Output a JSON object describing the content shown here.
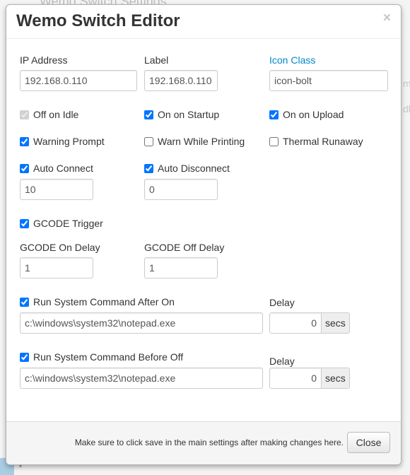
{
  "background": {
    "title_fragment": "Wemo Switch Settings",
    "frag_1": "m",
    "frag_2": "dle"
  },
  "modal": {
    "title": "Wemo Switch Editor",
    "close_symbol": "×",
    "fields": {
      "ip_address": {
        "label": "IP Address",
        "value": "192.168.0.110"
      },
      "label": {
        "label": "Label",
        "value": "192.168.0.110"
      },
      "icon_class": {
        "label": "Icon Class",
        "value": "icon-bolt"
      }
    },
    "checkboxes": {
      "off_on_idle": {
        "label": "Off on Idle",
        "checked": true,
        "disabled": true
      },
      "on_on_startup": {
        "label": "On on Startup",
        "checked": true
      },
      "on_on_upload": {
        "label": "On on Upload",
        "checked": true
      },
      "warning_prompt": {
        "label": "Warning Prompt",
        "checked": true
      },
      "warn_while_printing": {
        "label": "Warn While Printing",
        "checked": false
      },
      "thermal_runaway": {
        "label": "Thermal Runaway",
        "checked": false
      },
      "auto_connect": {
        "label": "Auto Connect",
        "checked": true
      },
      "auto_disconnect": {
        "label": "Auto Disconnect",
        "checked": true
      },
      "gcode_trigger": {
        "label": "GCODE Trigger",
        "checked": true
      },
      "run_after_on": {
        "label": "Run System Command After On",
        "checked": true
      },
      "run_before_off": {
        "label": "Run System Command Before Off",
        "checked": true
      }
    },
    "auto_connect_value": "10",
    "auto_disconnect_value": "0",
    "gcode_on_delay": {
      "label": "GCODE On Delay",
      "value": "1"
    },
    "gcode_off_delay": {
      "label": "GCODE Off Delay",
      "value": "1"
    },
    "after_on": {
      "command": "c:\\windows\\system32\\notepad.exe",
      "delay_label": "Delay",
      "delay_value": "0",
      "unit": "secs"
    },
    "before_off": {
      "command": "c:\\windows\\system32\\notepad.exe",
      "delay_label": "Delay",
      "delay_value": "0",
      "unit": "secs"
    },
    "footer": {
      "note": "Make sure to click save in the main settings after making changes here.",
      "close_label": "Close"
    }
  },
  "colors": {
    "link": "#0088cc",
    "checkbox_accent": "#0075ff",
    "footer_bg": "#f5f5f5",
    "text": "#333333"
  }
}
